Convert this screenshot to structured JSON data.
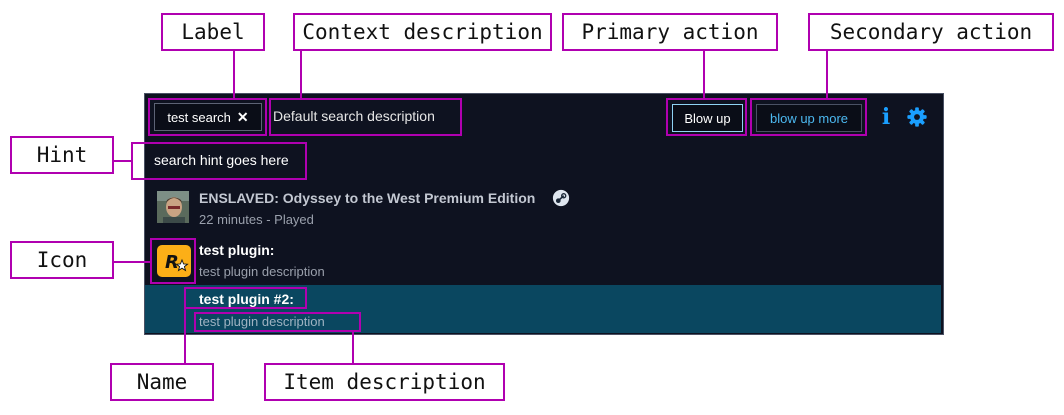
{
  "annotations": {
    "label": "Label",
    "context_description": "Context description",
    "primary_action": "Primary action",
    "secondary_action": "Secondary action",
    "hint": "Hint",
    "icon": "Icon",
    "name": "Name",
    "item_description": "Item description"
  },
  "ui": {
    "chip": {
      "label": "test search",
      "close_glyph": "✕"
    },
    "context_description": "Default search description",
    "primary_button": "Blow up",
    "secondary_button": "blow up more",
    "info_glyph": "i",
    "hint_text": "search hint goes here",
    "results": [
      {
        "title": "ENSLAVED: Odyssey to the West Premium Edition",
        "subtitle": "22 minutes - Played",
        "icon": "game-avatar-icon",
        "badge_icon": "steam-icon"
      },
      {
        "title": "test plugin:",
        "subtitle": "test plugin description",
        "icon": "rockstar-logo-icon"
      },
      {
        "title": "test plugin #2:",
        "subtitle": "test plugin description",
        "selected": true
      }
    ]
  },
  "colors": {
    "annotation_border": "#b000b0",
    "panel_bg": "#0e1220",
    "selected_row_bg": "#0a4760",
    "accent_blue": "#1a9fff",
    "secondary_button_text": "#4cb8f0"
  }
}
